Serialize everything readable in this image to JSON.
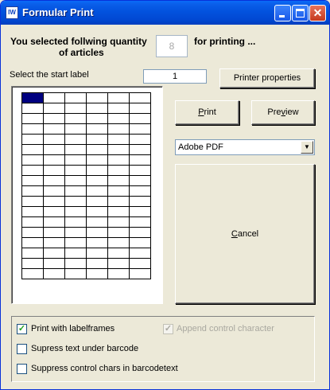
{
  "window": {
    "title": "Formular Print",
    "icon": "print-form-app-icon",
    "controls": [
      "minimize-icon",
      "maximize-icon",
      "close-icon"
    ],
    "close_glyph": "✕"
  },
  "quantity": {
    "prefix": "You selected follwing quantity",
    "prefix_line2": "of articles",
    "value": "8",
    "suffix": "for printing ..."
  },
  "start_label": {
    "label": "Select the start label",
    "value": "1"
  },
  "buttons": {
    "printer_properties": "Printer properties",
    "print_hotkey": "P",
    "print_rest": "rint",
    "preview_pre": "Pre",
    "preview_hotkey": "v",
    "preview_rest": "iew",
    "cancel_hotkey": "C",
    "cancel_rest": "ancel"
  },
  "printer_select": {
    "selected": "Adobe PDF"
  },
  "label_grid": {
    "columns": 6,
    "rows": 18,
    "selected_row": 0,
    "selected_col": 0
  },
  "options": {
    "print_labelframes": {
      "label": "Print with labelframes",
      "checked": true,
      "enabled": true
    },
    "append_control_char": {
      "label": "Append control character",
      "checked": true,
      "enabled": false
    },
    "supress_text": {
      "label": "Supress text under barcode",
      "checked": false,
      "enabled": true
    },
    "suppress_control_chars": {
      "label": "Suppress control chars in barcodetext",
      "checked": false,
      "enabled": true
    }
  },
  "colors": {
    "titlebar": "#0252de",
    "face": "#ece9d8",
    "selected_cell": "#000080",
    "check": "#21a121"
  }
}
